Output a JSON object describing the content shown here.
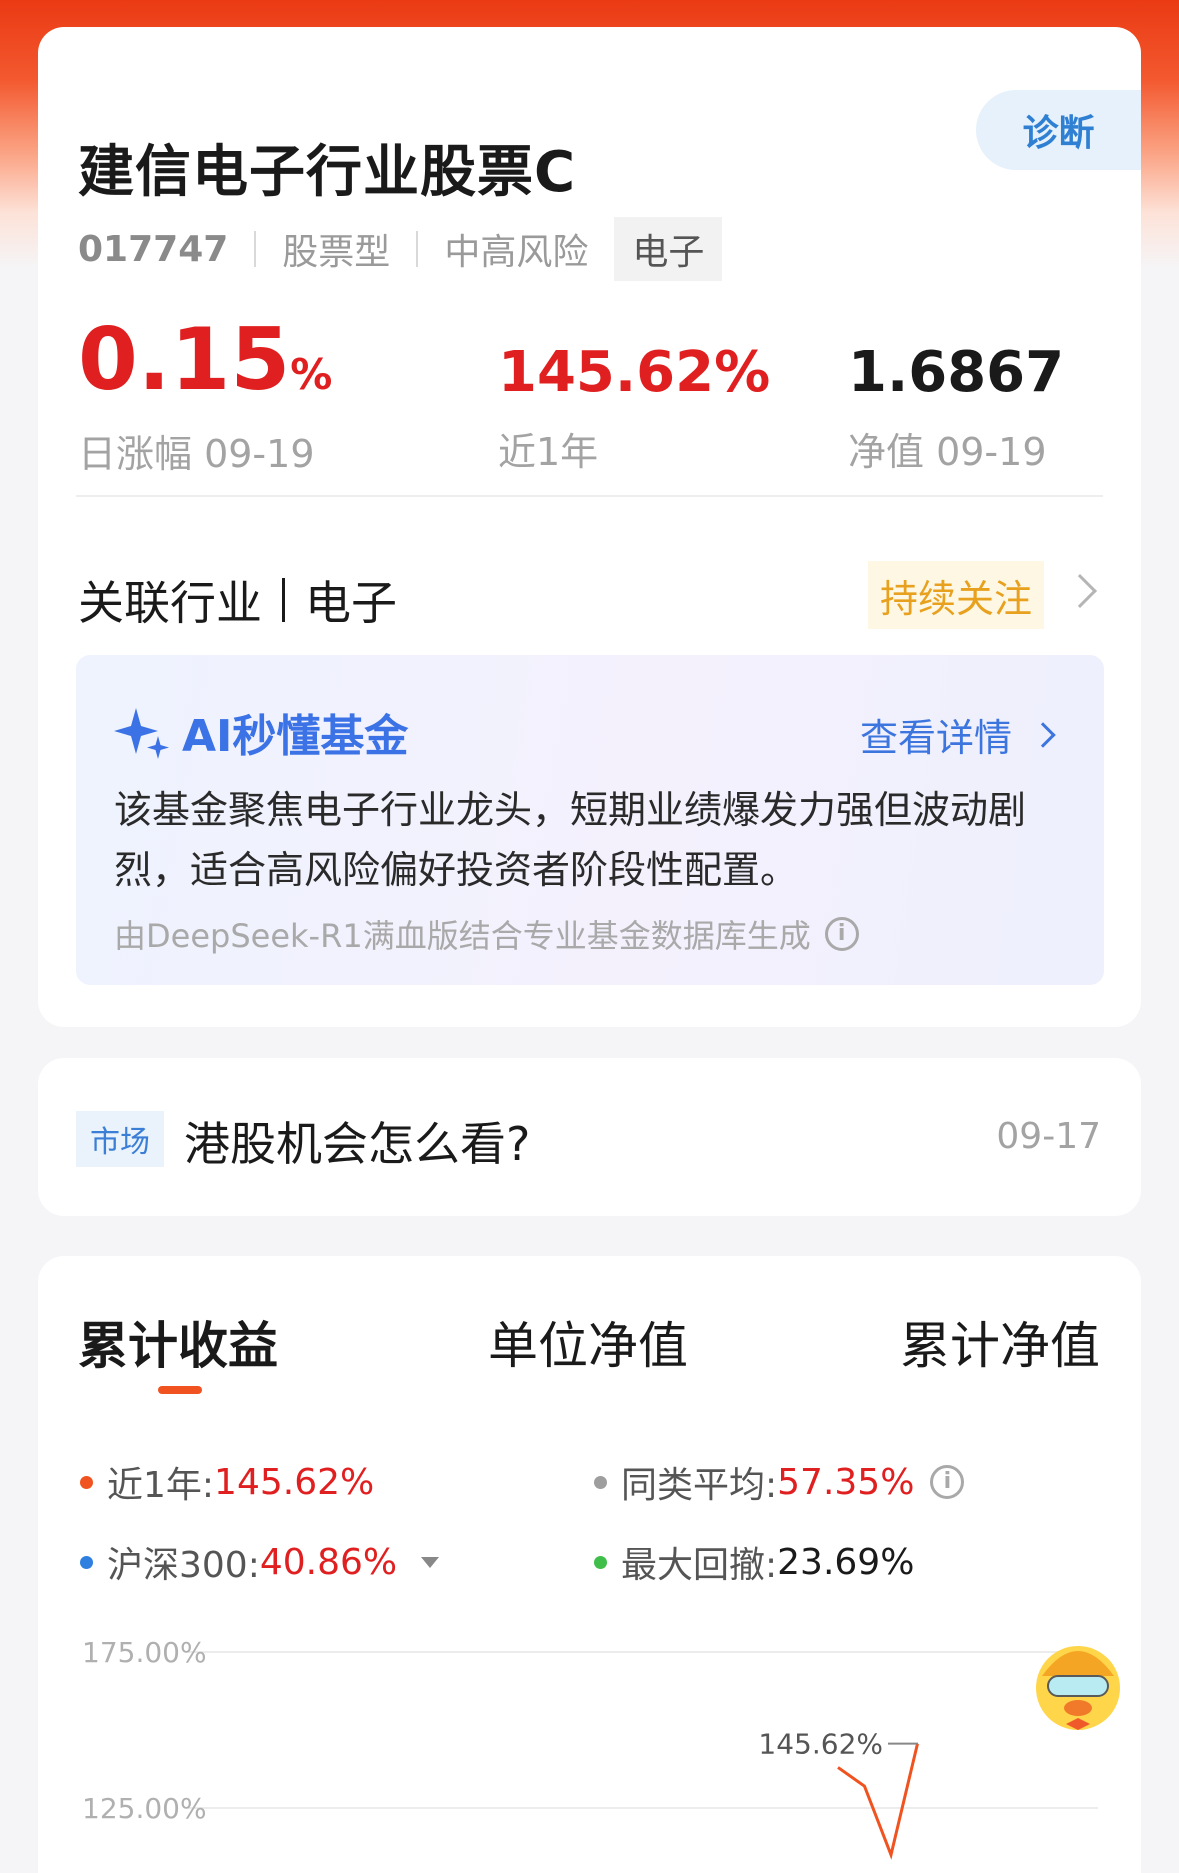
{
  "fund": {
    "name": "建信电子行业股票C",
    "code": "017747",
    "type": "股票型",
    "risk": "中高风险",
    "sector_tag": "电子",
    "diagnose_label": "诊断"
  },
  "stats": {
    "daily_change_value": "0.15",
    "daily_change_unit": "%",
    "daily_change_label": "日涨幅 09-19",
    "one_year_value": "145.62%",
    "one_year_label": "近1年",
    "nav_value": "1.6867",
    "nav_label": "净值 09-19"
  },
  "industry": {
    "label": "关联行业",
    "name": "电子",
    "follow_label": "持续关注"
  },
  "ai_summary": {
    "title": "AI秒懂基金",
    "more_label": "查看详情",
    "text": "该基金聚焦电子行业龙头，短期业绩爆发力强但波动剧烈，适合高风险偏好投资者阶段性配置。",
    "note": "由DeepSeek-R1满血版结合专业基金数据库生成"
  },
  "news": {
    "tag": "市场",
    "title": "港股机会怎么看?",
    "date": "09-17"
  },
  "chart_tabs": [
    "累计收益",
    "单位净值",
    "累计净值"
  ],
  "legend": {
    "near_year_label": "近1年:",
    "near_year_value": "145.62%",
    "peer_avg_label": "同类平均:",
    "peer_avg_value": "57.35%",
    "hs300_label": "沪深300:",
    "hs300_value": "40.86%",
    "max_drawdown_label": "最大回撤:",
    "max_drawdown_value": "23.69%"
  },
  "colors": {
    "accent_red": "#e02020",
    "series_orange": "#f0531f",
    "series_blue": "#2f7fe0",
    "series_gray": "#9e9e9e",
    "series_green": "#3fbf4a"
  },
  "chart_data": {
    "type": "line",
    "ytick_labels": [
      "175.00%",
      "125.00%"
    ],
    "yticks": [
      175,
      125
    ],
    "end_label": "145.62%",
    "series": [
      {
        "name": "近1年",
        "x": [
          0.0,
          0.05,
          0.1,
          0.15
        ],
        "values": [
          138,
          132,
          110,
          145.62
        ]
      }
    ]
  }
}
